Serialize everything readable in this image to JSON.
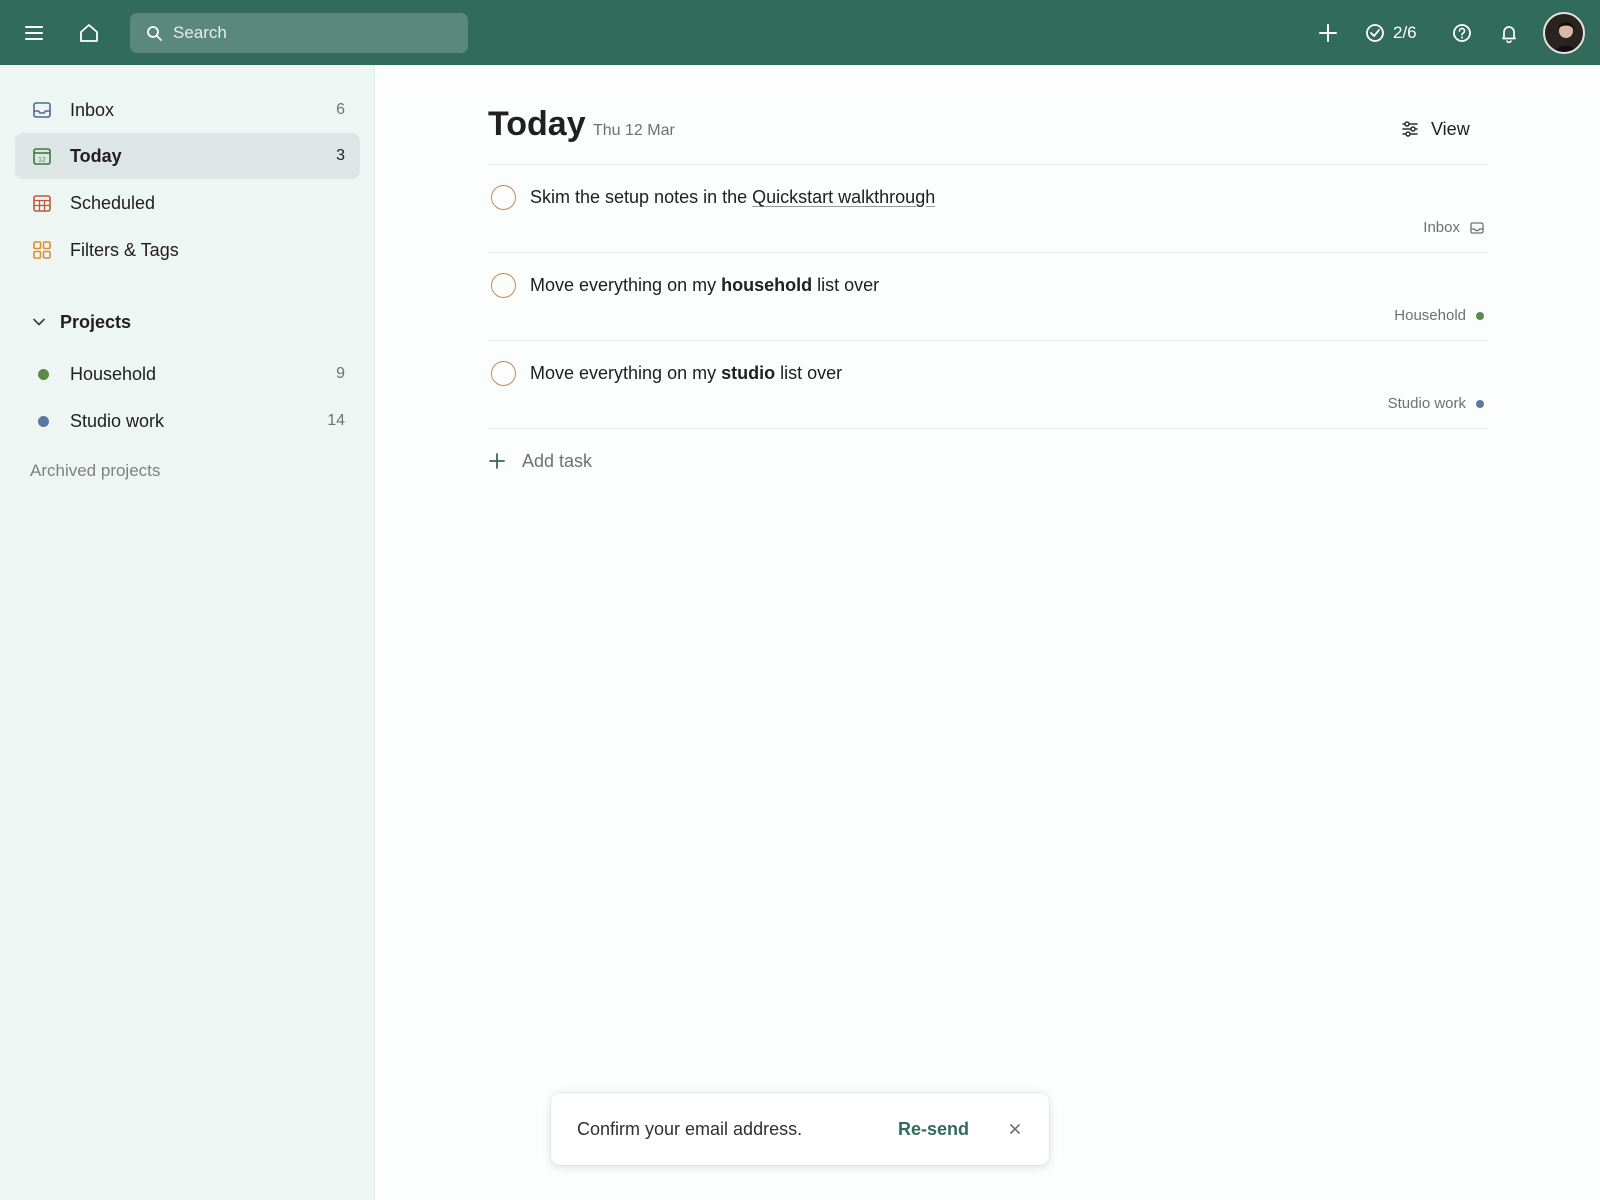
{
  "topbar": {
    "search_placeholder": "Search",
    "progress_label": "2/6",
    "icons": [
      "menu-icon",
      "home-icon",
      "search-icon",
      "plus-icon",
      "check-circle-icon",
      "help-icon",
      "bell-icon"
    ]
  },
  "sidebar": {
    "items": [
      {
        "label": "Inbox",
        "count": "6",
        "icon": "inbox-icon",
        "color": "#4c6a9a"
      },
      {
        "label": "Today",
        "count": "3",
        "icon": "calendar-today-icon",
        "color": "#3c7a3c"
      },
      {
        "label": "Scheduled",
        "count": "",
        "icon": "calendar-grid-icon",
        "color": "#c0583a"
      },
      {
        "label": "Filters & Tags",
        "count": "",
        "icon": "grid-icon",
        "color": "#d98e2f"
      }
    ],
    "projects_label": "Projects",
    "projects": [
      {
        "label": "Household",
        "count": "9",
        "color": "#5a8a4a"
      },
      {
        "label": "Studio work",
        "count": "14",
        "color": "#5b78a0"
      }
    ],
    "archived_label": "Archived projects"
  },
  "main": {
    "title": "Today",
    "date": "Thu 12 Mar",
    "view_label": "View",
    "tasks": [
      {
        "prefix": "Skim the setup notes in the ",
        "link": "Quickstart walkthrough",
        "project": "Inbox"
      },
      {
        "prefix": "Move everything on my ",
        "bold": "household",
        "suffix": " list over",
        "project": "Household",
        "project_color": "#5a8a4a"
      },
      {
        "prefix": "Move everything on my ",
        "bold": "studio",
        "suffix": " list over",
        "project": "Studio work",
        "project_color": "#5b78a0"
      }
    ],
    "add_task_label": "Add task"
  },
  "toast": {
    "message": "Confirm your email address.",
    "action": "Re-send"
  },
  "colors": {
    "topbar": "#316b5c",
    "accent": "#316b5c",
    "checkbox": "#c9894a"
  }
}
